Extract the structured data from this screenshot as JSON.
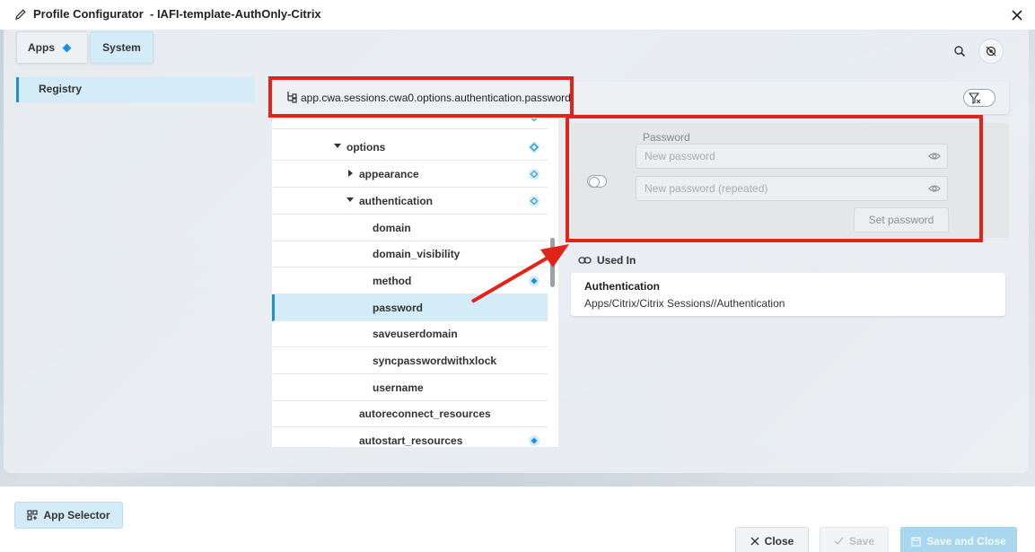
{
  "window": {
    "title": "Profile Configurator  - IAFI-template-AuthOnly-Citrix"
  },
  "tabs": [
    {
      "label": "Apps",
      "active": false
    },
    {
      "label": "System",
      "active": true
    }
  ],
  "nav": {
    "registry_label": "Registry"
  },
  "pathbar": {
    "path": "app.cwa.sessions.cwa0.options.authentication.password"
  },
  "tree": {
    "rows": [
      {
        "label": "options",
        "caret": "down"
      },
      {
        "label": "appearance",
        "caret": "right"
      },
      {
        "label": "authentication",
        "caret": "down"
      },
      {
        "label": "domain"
      },
      {
        "label": "domain_visibility"
      },
      {
        "label": "method"
      },
      {
        "label": "password",
        "selected": true
      },
      {
        "label": "saveuserdomain"
      },
      {
        "label": "syncpasswordwithxlock"
      },
      {
        "label": "username"
      },
      {
        "label": "autoreconnect_resources"
      },
      {
        "label": "autostart_resources"
      }
    ]
  },
  "password_editor": {
    "label": "Password",
    "new_placeholder": "New password",
    "repeat_placeholder": "New password (repeated)",
    "set_button": "Set password"
  },
  "used_in": {
    "heading": "Used In",
    "items": [
      {
        "title": "Authentication",
        "path": "Apps/Citrix/Citrix Sessions//Authentication"
      }
    ]
  },
  "footer": {
    "app_selector": "App Selector",
    "close": "Close",
    "save": "Save",
    "save_and_close": "Save and Close"
  },
  "colors": {
    "accent": "#1e90d8",
    "selection": "#d4ecf7",
    "annotation": "#e2231a"
  }
}
